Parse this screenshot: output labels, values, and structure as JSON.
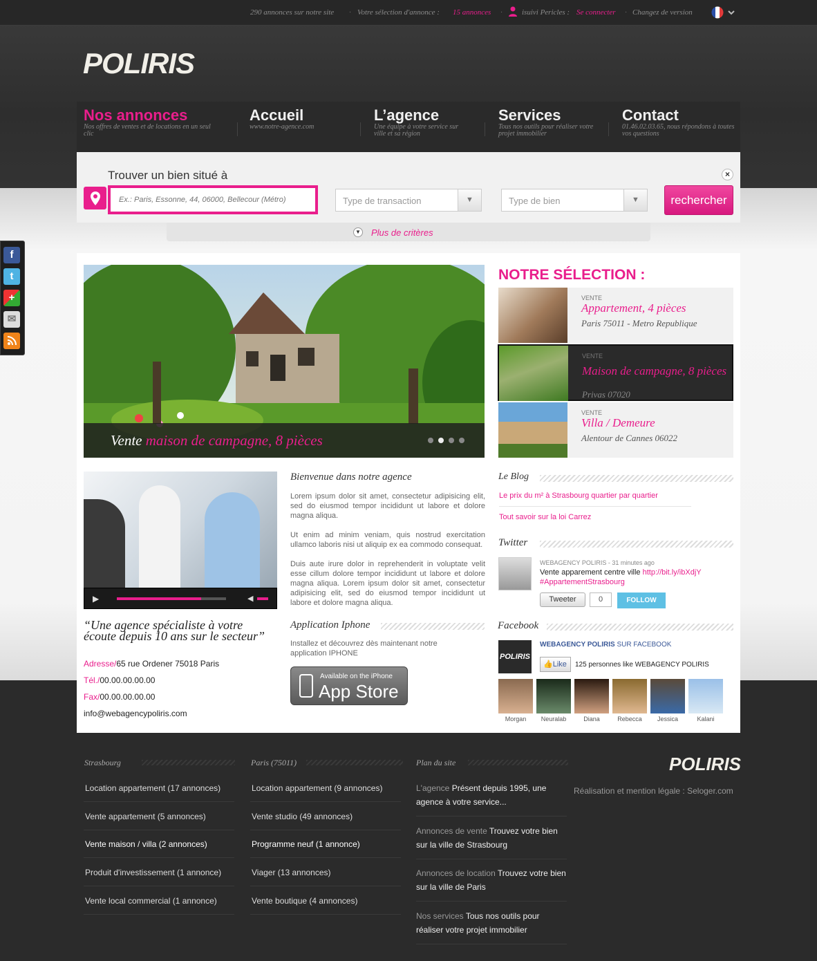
{
  "topbar": {
    "count_text": "290 annonces sur notre site",
    "selection_label": "Votre sélection d'annonce :",
    "selection_count": "15 annonces",
    "user_label": "isuivi Pericles :",
    "login": "Se connecter",
    "version": "Changez de version"
  },
  "logo": "POLIRIS",
  "nav": [
    {
      "title": "Nos annonces",
      "sub": "Nos offres de ventes et  de locations en un seul clic"
    },
    {
      "title": "Accueil",
      "sub": "www.notre-agence.com"
    },
    {
      "title": "L’agence",
      "sub": "Une équipe à votre service sur ville et sa région"
    },
    {
      "title": "Services",
      "sub": "Tous nos outils pour réaliser votre projet immobilier"
    },
    {
      "title": "Contact",
      "sub": "01.46.02.03.65, nous répondons à toutes vos questions"
    }
  ],
  "search": {
    "title": "Trouver un bien situé à",
    "placeholder": "Ex.: Paris, Essonne, 44, 06000, Bellecour (Métro)",
    "transaction": "Type de transaction",
    "property": "Type de bien",
    "button": "rechercher",
    "more": "Plus de critères"
  },
  "slider": {
    "caption_prefix": "Vente",
    "caption_title": "maison de campagne, 8 pièces",
    "dots": 4,
    "active_dot": 2
  },
  "selection": {
    "title": "NOTRE SÉLECTION :",
    "items": [
      {
        "kind": "VENTE",
        "name": "Appartement, 4 pièces",
        "place": "Paris 75011 - Metro Republique"
      },
      {
        "kind": "VENTE",
        "name": "Maison de campagne, 8 pièces",
        "place": "Privas 07020"
      },
      {
        "kind": "VENTE",
        "name": "Villa / Demeure",
        "place": "Alentour de Cannes 06022"
      }
    ]
  },
  "about": {
    "quote": "“Une agence spécialiste à votre écoute depuis 10 ans sur le secteur”",
    "address_label": "Adresse/",
    "address": "65 rue Ordener 75018 Paris",
    "tel_label": "Tél./",
    "tel": "00.00.00.00.00",
    "fax_label": "Fax/",
    "fax": "00.00.00.00.00",
    "email": "info@webagencypoliris.com"
  },
  "welcome": {
    "title": "Bienvenue dans notre agence",
    "p1": "Lorem ipsum dolor sit amet, consectetur adipisicing elit, sed do eiusmod tempor incididunt ut labore et dolore magna aliqua.",
    "p2": "Ut enim ad minim veniam, quis nostrud exercitation ullamco laboris nisi ut aliquip ex ea commodo consequat.",
    "p3": "Duis aute irure dolor in reprehenderit in voluptate velit esse cillum dolore tempor incididunt ut labore et dolore magna aliqua. Lorem ipsum dolor sit amet, consectetur adipisicing elit, sed do eiusmod tempor incididunt ut labore et dolore magna aliqua."
  },
  "iphone": {
    "title": "Application Iphone",
    "text": "Installez et découvrez dès maintenant notre application IPHONE",
    "badge_small": "Available on the iPhone",
    "badge_big": "App Store"
  },
  "blog": {
    "title": "Le Blog",
    "links": [
      "Le prix du m² à Strasbourg quartier par quartier",
      "Tout savoir sur la loi Carrez"
    ]
  },
  "twitter": {
    "title": "Twitter",
    "meta": "WEBAGENCY POLIRIS - 31 minutes ago",
    "text": "Vente apparement centre ville",
    "link": "http://bit.ly/ibXdjY",
    "hashtag": "#AppartementStrasbourg",
    "tweet_btn": "Tweeter",
    "count": "0",
    "follow": "FOLLOW"
  },
  "facebook": {
    "title": "Facebook",
    "logo": "POLIRIS",
    "page": "WEBAGENCY POLIRIS",
    "on": "SUR FACEBOOK",
    "like": "Like",
    "likes_text": "125 personnes like WEBAGENCY POLIRIS",
    "fans": [
      "Morgan",
      "Neuralab",
      "Diana",
      "Rebecca",
      "Jessica",
      "Kalani"
    ]
  },
  "footer": {
    "col1": {
      "title": "Strasbourg",
      "links": [
        "Location appartement (17 annonces)",
        "Vente appartement (5 annonces)",
        "Vente maison / villa (2 annonces)",
        "Produit d'investissement (1 annonce)",
        "Vente local commercial (1 annonce)"
      ]
    },
    "col2": {
      "title": "Paris (75011)",
      "links": [
        "Location appartement (9 annonces)",
        "Vente studio (49 annonces)",
        "Programme neuf (1 annonce)",
        "Viager (13 annonces)",
        "Vente boutique (4 annonces)"
      ]
    },
    "col3": {
      "title": "Plan du site",
      "items": [
        {
          "label": "L'agence",
          "text": "Présent depuis 1995, une agence à votre service..."
        },
        {
          "label": "Annonces de vente",
          "text": "Trouvez votre bien sur la ville de Strasbourg"
        },
        {
          "label": "Annonces de location",
          "text": "Trouvez votre bien sur la ville de Paris"
        },
        {
          "label": "Nos services",
          "text": "Tous nos outils pour réaliser votre projet immobilier"
        }
      ]
    },
    "logo": "POLIRIS",
    "legal": "Réalisation et mention légale : Seloger.com"
  },
  "colors": {
    "accent": "#e91e8c",
    "dark": "#2b2b2b",
    "facebook": "#3b5998",
    "twitter": "#5ec0e4"
  }
}
